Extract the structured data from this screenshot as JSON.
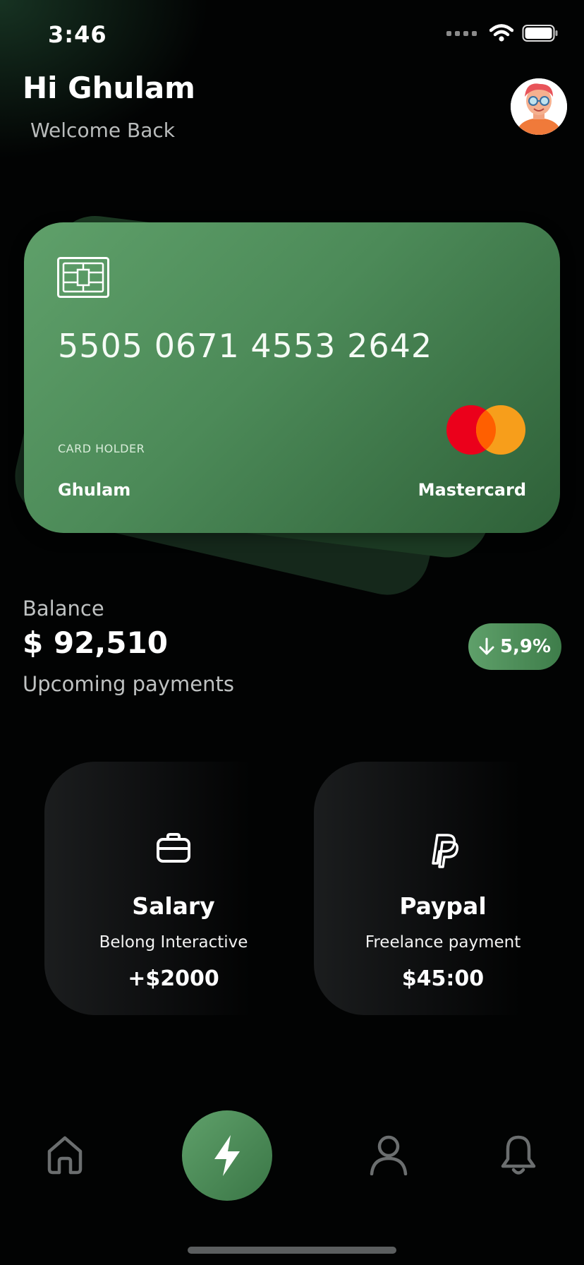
{
  "status_bar": {
    "time": "3:46",
    "signal_icon": "cellular-dots-icon",
    "wifi_icon": "wifi-icon",
    "battery_icon": "battery-icon"
  },
  "header": {
    "greeting": "Hi Ghulam",
    "subtitle": "Welcome Back",
    "avatar_icon": "user-avatar"
  },
  "card": {
    "chip_icon": "card-chip-icon",
    "number": "5505 0671 4553 2642",
    "holder_label": "CARD HOLDER",
    "holder_name": "Ghulam",
    "brand": "Mastercard",
    "brand_logo": "mastercard-logo",
    "gradient_colors": [
      "#5fa06a",
      "#2e6038"
    ]
  },
  "balance": {
    "label": "Balance",
    "value": "$ 92,510",
    "change": "5,9%",
    "change_icon": "arrow-down-icon",
    "upcoming_label": "Upcoming payments"
  },
  "payments": [
    {
      "icon": "briefcase-icon",
      "title": "Salary",
      "subtitle": "Belong Interactive",
      "amount": "+$2000"
    },
    {
      "icon": "paypal-icon",
      "title": "Paypal",
      "subtitle": "Freelance payment",
      "amount": "$45:00"
    }
  ],
  "nav": [
    {
      "icon": "home-icon",
      "active": false
    },
    {
      "icon": "lightning-icon",
      "active": true
    },
    {
      "icon": "user-icon",
      "active": false
    },
    {
      "icon": "bell-icon",
      "active": false
    }
  ],
  "colors": {
    "background": "#020303",
    "accent": "#5fa06a",
    "muted_text": "#bfc2c2",
    "nav_inactive": "#6b6e6f"
  }
}
